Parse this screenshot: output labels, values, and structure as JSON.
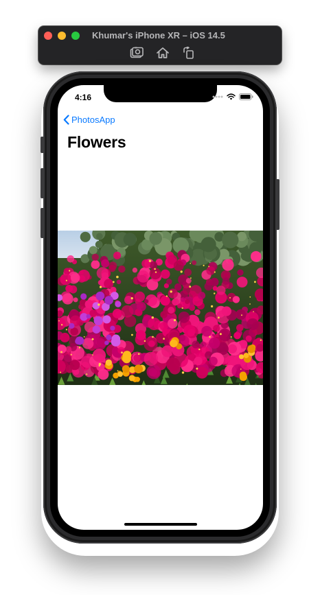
{
  "simulator": {
    "title": "Khumar's iPhone XR – iOS 14.5",
    "tools": [
      {
        "icon": "screenshot-icon"
      },
      {
        "icon": "home-icon"
      },
      {
        "icon": "rotate-icon"
      }
    ]
  },
  "status_bar": {
    "time": "4:16",
    "icons": [
      "signal-dots-icon",
      "wifi-icon",
      "battery-icon"
    ]
  },
  "nav": {
    "back_label": "PhotosApp",
    "title": "Flowers"
  },
  "colors": {
    "accent": "#0a7aff",
    "flower_magenta": "#e8006a",
    "flower_orange": "#f5a200"
  }
}
